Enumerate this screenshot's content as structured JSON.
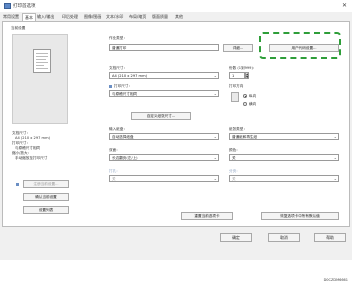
{
  "window": {
    "title": "打印首选项",
    "close": "✕"
  },
  "tabs": [
    "常用设置",
    "基本",
    "输入/输出",
    "印后处理",
    "图像/图画",
    "文本/水印",
    "布局/缩页",
    "版面质量",
    "其他"
  ],
  "left": {
    "section_title": "当前设置",
    "info_lines": [
      "文档尺寸：",
      "A4 (210 x 297 mm)",
      "打印尺寸：",
      "与原稿尺寸相同",
      "缩小/放大：",
      "手动缩放至打印尺寸"
    ],
    "buttons": [
      "注册当前设置...",
      "确认当前设置",
      "设置列表"
    ]
  },
  "main": {
    "job_type_label": "作业类型：",
    "job_type_value": "普通打印",
    "detail_button": "详细...",
    "user_code_button": "用户代码设置...",
    "doc_size_label": "文档尺寸：",
    "doc_size_value": "A4 (210 x 297 mm)",
    "copies_label": "份数 (1到999)：",
    "copies_value": "1",
    "print_size_label": "打印尺寸：",
    "print_size_value": "与原稿尺寸相同",
    "orientation_label": "打印方向",
    "orientation_options": [
      "纵向",
      "横向"
    ],
    "register_size_button": "自定义纸张尺寸...",
    "input_tray_label": "输入纸盘：",
    "input_tray_value": "自动选择纸盘",
    "paper_type_label": "纸张类型：",
    "paper_type_value": "普通纸和再生纸",
    "duplex_label": "双面：",
    "duplex_value": "长边翻页(左/上)",
    "color_label": "颜色：",
    "color_value": "关",
    "staple_label": "打孔：",
    "staple_value": "关",
    "punch_label": "分页：",
    "punch_value": "关",
    "reset_tab_button": "重置当前选项卡",
    "reset_all_button": "恢复选项卡中所有默认值"
  },
  "bottom": {
    "ok": "确定",
    "cancel": "取消",
    "help": "帮助"
  },
  "footer_code": "D0CZDM6661",
  "accent": "#2e9e39"
}
